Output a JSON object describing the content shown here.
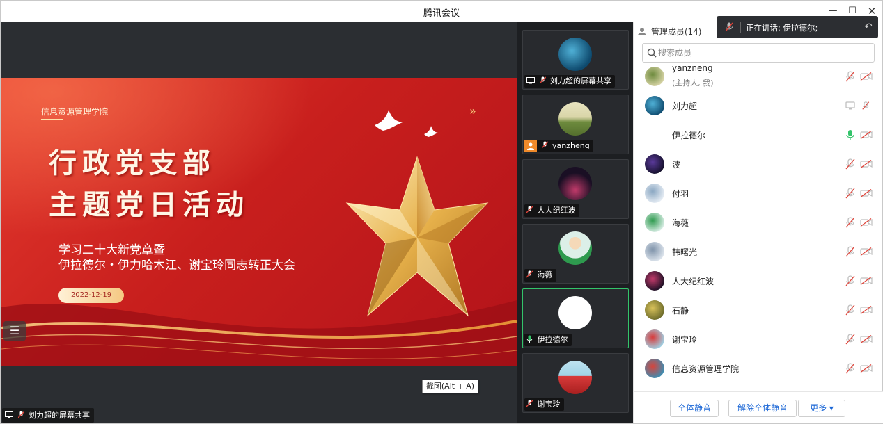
{
  "app": {
    "title": "腾讯会议"
  },
  "window_controls": {
    "minimize": "—",
    "maximize": "☐",
    "close": "✕"
  },
  "stage": {
    "share_label": "刘力超的屏幕共享",
    "list_toggle_glyph": "☰",
    "tooltip": "截图(Alt + A)",
    "slide": {
      "school": "信息资源管理学院",
      "title_line1": "行政党支部",
      "title_line2": "主题党日活动",
      "subtitle_line1": "学习二十大新党章暨",
      "subtitle_line2": "伊拉德尔・伊力哈木江、谢宝玲同志转正大会",
      "date": "2022-12-19",
      "chevrons": "»"
    }
  },
  "video_tiles": [
    {
      "label": "刘力超的屏幕共享",
      "avatar": "starry-sky",
      "colors": [
        "#0e4a6e",
        "#4fb0d6"
      ]
    },
    {
      "label": "yanzheng",
      "avatar": "grassland",
      "colors": [
        "#d9d5a8",
        "#6d8a3d"
      ]
    },
    {
      "label": "人大纪红波",
      "avatar": "night-city",
      "colors": [
        "#1a0f24",
        "#c13a6a"
      ]
    },
    {
      "label": "海薇",
      "avatar": "child-photo",
      "colors": [
        "#dcefe8",
        "#2e9a4e"
      ]
    },
    {
      "label": "伊拉德尔",
      "avatar": "blank",
      "colors": [
        "#ffffff",
        "#ffffff"
      ]
    },
    {
      "label": "谢宝玲",
      "avatar": "red-dress",
      "colors": [
        "#9fd3e6",
        "#d83a3a"
      ]
    }
  ],
  "panel": {
    "header": "管理成员(14)",
    "search_placeholder": "搜索成员",
    "members": [
      {
        "name": "yanzheng",
        "role": "(主持人, 我)",
        "avatar_colors": [
          "#d9d5a8",
          "#6d8a3d"
        ],
        "mic": "muted",
        "extra": "video-off"
      },
      {
        "name": "刘力超",
        "role": "",
        "avatar_colors": [
          "#0e4a6e",
          "#4fb0d6"
        ],
        "mic": "screen-share",
        "extra": "muted"
      },
      {
        "name": "伊拉德尔",
        "role": "",
        "avatar_colors": [
          "#ffffff",
          "#ffffff"
        ],
        "mic": "active",
        "extra": "video-off"
      },
      {
        "name": "波",
        "role": "",
        "avatar_colors": [
          "#14102a",
          "#5a3a9a"
        ],
        "mic": "muted",
        "extra": "video-off"
      },
      {
        "name": "付羽",
        "role": "",
        "avatar_colors": [
          "#e8eef5",
          "#8aa7c2"
        ],
        "mic": "muted",
        "extra": "video-off"
      },
      {
        "name": "海薇",
        "role": "",
        "avatar_colors": [
          "#dcefe8",
          "#2e9a4e"
        ],
        "mic": "muted",
        "extra": "video-off"
      },
      {
        "name": "韩曙光",
        "role": "",
        "avatar_colors": [
          "#dfe6ee",
          "#7f93aa"
        ],
        "mic": "muted",
        "extra": "video-off"
      },
      {
        "name": "人大纪红波",
        "role": "",
        "avatar_colors": [
          "#1a0f24",
          "#c13a6a"
        ],
        "mic": "muted",
        "extra": "video-off"
      },
      {
        "name": "石静",
        "role": "",
        "avatar_colors": [
          "#6b6a2a",
          "#d9c25a"
        ],
        "mic": "muted",
        "extra": "video-off"
      },
      {
        "name": "谢宝玲",
        "role": "",
        "avatar_colors": [
          "#9fd3e6",
          "#d83a3a"
        ],
        "mic": "muted",
        "extra": "video-off"
      },
      {
        "name": "信息资源管理学院",
        "role": "",
        "avatar_colors": [
          "#3a8fb5",
          "#d8433a"
        ],
        "mic": "muted",
        "extra": "video-off"
      }
    ],
    "buttons": {
      "mute_all": "全体静音",
      "unmute_all": "解除全体静音",
      "more": "更多 ▾"
    }
  },
  "toast": {
    "text": "正在讲话: 伊拉德尔;",
    "back_glyph": "↶"
  },
  "colors": {
    "accent_blue": "#1a66d6",
    "active_green": "#33c46a",
    "muted_red": "#e0443a",
    "slide_red": "#c81f1d"
  }
}
